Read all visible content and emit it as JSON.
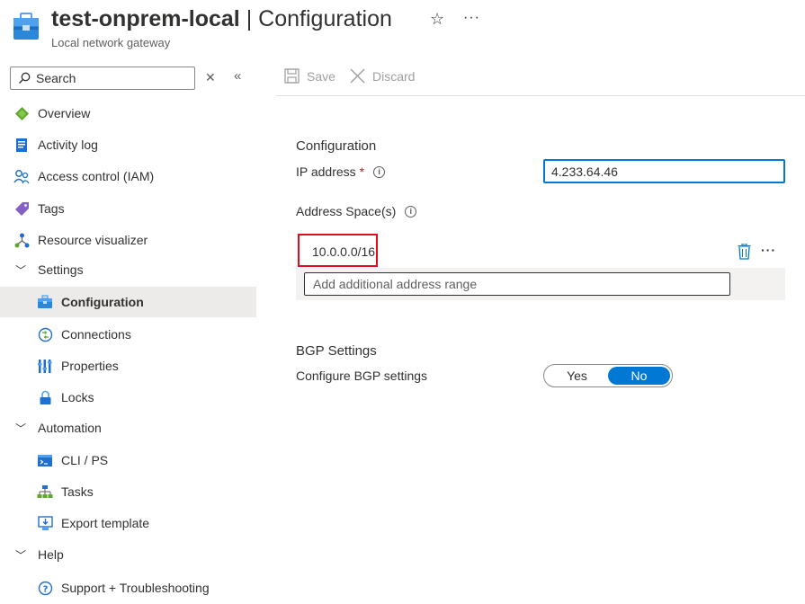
{
  "header": {
    "resource_name": "test-onprem-local",
    "separator": "|",
    "page_name": "Configuration",
    "subtitle": "Local network gateway",
    "star_icon": "☆",
    "more_icon": "···"
  },
  "sidebar": {
    "search_placeholder": "Search",
    "items": [
      {
        "label": "Overview",
        "icon": "overview-icon"
      },
      {
        "label": "Activity log",
        "icon": "activity-log-icon"
      },
      {
        "label": "Access control (IAM)",
        "icon": "iam-icon"
      },
      {
        "label": "Tags",
        "icon": "tag-icon"
      },
      {
        "label": "Resource visualizer",
        "icon": "resource-visualizer-icon"
      },
      {
        "label": "Settings",
        "icon": "chevron-down-icon"
      },
      {
        "label": "Configuration",
        "icon": "configuration-icon"
      },
      {
        "label": "Connections",
        "icon": "connections-icon"
      },
      {
        "label": "Properties",
        "icon": "properties-icon"
      },
      {
        "label": "Locks",
        "icon": "lock-icon"
      },
      {
        "label": "Automation",
        "icon": "chevron-down-icon"
      },
      {
        "label": "CLI / PS",
        "icon": "cli-icon"
      },
      {
        "label": "Tasks",
        "icon": "tasks-icon"
      },
      {
        "label": "Export template",
        "icon": "export-template-icon"
      },
      {
        "label": "Help",
        "icon": "chevron-down-icon"
      },
      {
        "label": "Support + Troubleshooting",
        "icon": "support-icon"
      }
    ]
  },
  "toolbar": {
    "save_label": "Save",
    "discard_label": "Discard"
  },
  "config": {
    "section_title": "Configuration",
    "ip_label": "IP address",
    "required_mark": "*",
    "ip_value": "4.233.64.46",
    "address_space_label": "Address Space(s)",
    "address_range": "10.0.0.0/16",
    "add_range_placeholder": "Add additional address range",
    "row_more_icon": "···"
  },
  "bgp": {
    "section_title": "BGP Settings",
    "configure_label": "Configure BGP settings",
    "yes_label": "Yes",
    "no_label": "No",
    "selected": "No"
  },
  "colors": {
    "accent": "#0078d4",
    "highlight_border": "#e00b1c",
    "active_nav_bg": "#edebe9"
  }
}
